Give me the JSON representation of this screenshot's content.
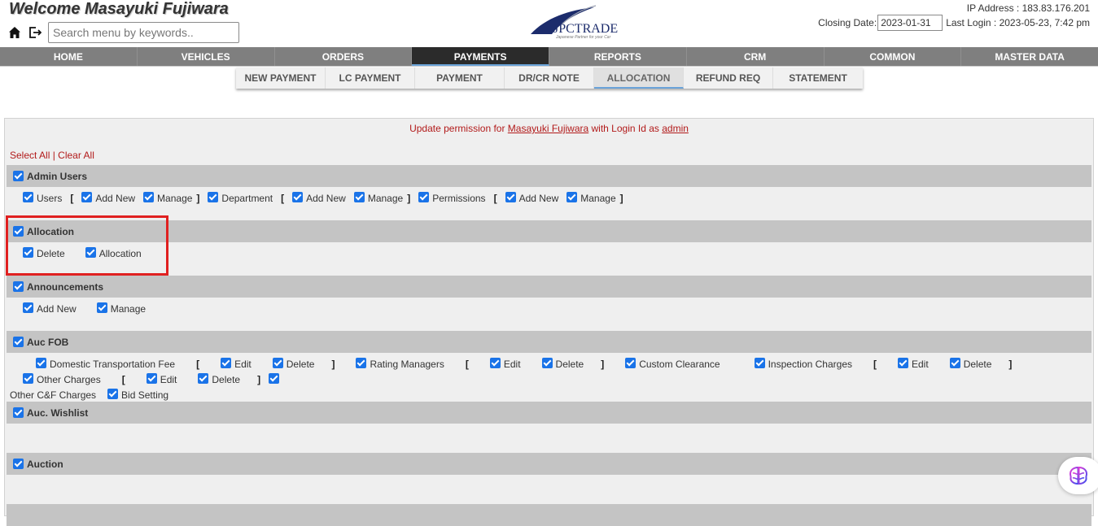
{
  "header": {
    "welcome": "Welcome Masayuki Fujiwara",
    "search_placeholder": "Search menu by keywords..",
    "logo_text": "JPCTRADE",
    "logo_tagline": "Japanese Partner for your Car",
    "ip_address": "IP Address : 183.83.176.201",
    "closing_label": "Closing Date:",
    "closing_date": "2023-01-31",
    "last_login": "Last Login : 2023-05-23, 7:42 pm"
  },
  "main_nav": [
    "HOME",
    "VEHICLES",
    "ORDERS",
    "PAYMENTS",
    "REPORTS",
    "CRM",
    "COMMON",
    "MASTER DATA"
  ],
  "main_nav_active": "PAYMENTS",
  "sub_nav": [
    "NEW PAYMENT",
    "LC PAYMENT",
    "PAYMENT",
    "DR/CR NOTE",
    "ALLOCATION",
    "REFUND REQ",
    "STATEMENT"
  ],
  "sub_nav_active": "ALLOCATION",
  "update": {
    "prefix": "Update permission for ",
    "user": "Masayuki Fujiwara",
    "middle": " with Login Id as ",
    "login_id": "admin"
  },
  "select_all": "Select All",
  "separator": "|",
  "clear_all": "Clear All",
  "sections": {
    "admin_users": {
      "title": "Admin Users",
      "users": "Users",
      "add_new_1": "Add New",
      "manage_1": "Manage",
      "department": "Department",
      "add_new_2": "Add New",
      "manage_2": "Manage",
      "permissions": "Permissions",
      "add_new_3": "Add New",
      "manage_3": "Manage"
    },
    "allocation": {
      "title": "Allocation",
      "delete": "Delete",
      "allocation": "Allocation"
    },
    "announcements": {
      "title": "Announcements",
      "add_new": "Add New",
      "manage": "Manage"
    },
    "auc_fob": {
      "title": "Auc FOB",
      "domestic": "Domestic Transportation Fee",
      "edit_1": "Edit",
      "delete_1": "Delete",
      "rating": "Rating Managers",
      "edit_2": "Edit",
      "delete_2": "Delete",
      "custom": "Custom Clearance",
      "inspection": "Inspection Charges",
      "edit_3": "Edit",
      "delete_3": "Delete",
      "other": "Other Charges",
      "edit_4": "Edit",
      "delete_4": "Delete",
      "other_cf": "Other C&F Charges",
      "bid": "Bid Setting"
    },
    "auc_wishlist": {
      "title": "Auc. Wishlist"
    },
    "auction": {
      "title": "Auction"
    }
  },
  "brackets": {
    "open": "[",
    "close": "]"
  },
  "colors": {
    "accent": "#1a73e8",
    "nav_bg": "#7f7f7f",
    "nav_active": "#2b2b2b",
    "link_red": "#b21a1a",
    "highlight": "#e02020"
  }
}
